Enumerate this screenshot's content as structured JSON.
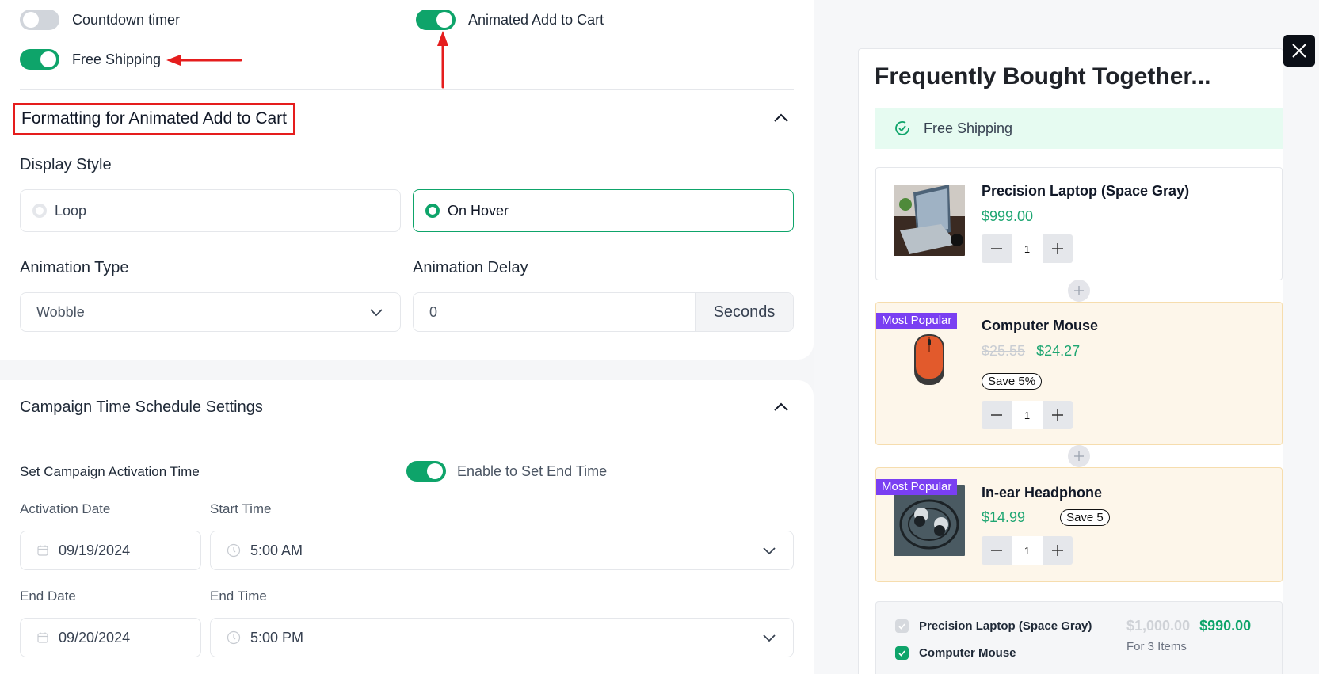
{
  "settings": {
    "toggles": {
      "countdown_timer": {
        "label": "Countdown timer",
        "on": false
      },
      "animated_add_to_cart": {
        "label": "Animated Add to Cart",
        "on": true
      },
      "free_shipping": {
        "label": "Free Shipping",
        "on": true
      }
    },
    "formatting_section": {
      "title": "Formatting for Animated Add to Cart",
      "display_style_label": "Display Style",
      "display_options": [
        {
          "label": "Loop",
          "selected": false
        },
        {
          "label": "On Hover",
          "selected": true
        }
      ],
      "animation_type_label": "Animation Type",
      "animation_type_value": "Wobble",
      "animation_delay_label": "Animation Delay",
      "animation_delay_value": "0",
      "animation_delay_suffix": "Seconds"
    },
    "schedule_section": {
      "title": "Campaign Time Schedule Settings",
      "activation_label": "Set Campaign Activation Time",
      "end_time_toggle": {
        "label": "Enable to Set End Time",
        "on": true
      },
      "activation_date_label": "Activation Date",
      "activation_date": "09/19/2024",
      "start_time_label": "Start Time",
      "start_time": "5:00 AM",
      "end_date_label": "End Date",
      "end_date": "09/20/2024",
      "end_time_label": "End Time",
      "end_time": "5:00 PM"
    }
  },
  "preview": {
    "title": "Frequently Bought Together...",
    "shipping_banner": "Free Shipping",
    "products": [
      {
        "name": "Precision Laptop (Space Gray)",
        "price": "$999.00",
        "old_price": null,
        "save": null,
        "qty": "1",
        "badge": null
      },
      {
        "name": "Computer Mouse",
        "price": "$24.27",
        "old_price": "$25.55",
        "save": "Save 5%",
        "qty": "1",
        "badge": "Most Popular"
      },
      {
        "name": "In-ear Headphone",
        "price": "$14.99",
        "old_price": null,
        "save": "Save 5",
        "qty": "1",
        "badge": "Most Popular"
      }
    ],
    "summary": {
      "items": [
        {
          "label": "Precision Laptop (Space Gray)",
          "checked": true,
          "disabled": true
        },
        {
          "label": "Computer Mouse",
          "checked": true,
          "disabled": false
        }
      ],
      "old_total": "$1,000.00",
      "new_total": "$990.00",
      "subtitle": "For 3 Items"
    }
  },
  "colors": {
    "accent_green": "#0ea46a",
    "annotation_red": "#e51d1d",
    "badge_purple": "#7a3ff2",
    "popular_bg": "#fdf6ea",
    "shipping_bg": "#e6fbf1"
  }
}
